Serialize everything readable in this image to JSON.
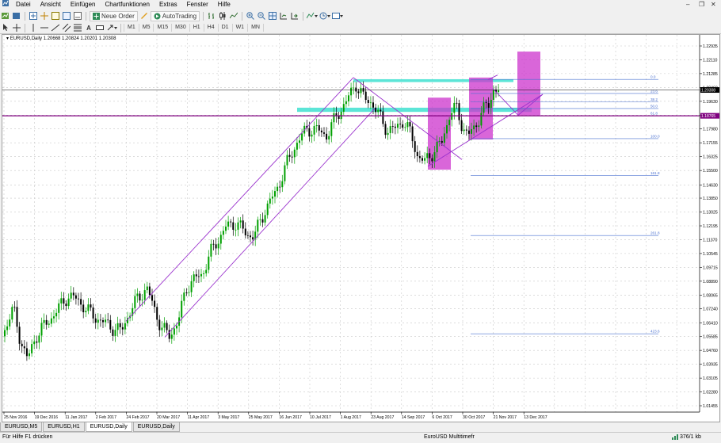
{
  "menu": [
    "Datei",
    "Ansicht",
    "Einfügen",
    "Chartfunktionen",
    "Extras",
    "Fenster",
    "Hilfe"
  ],
  "toolbar": {
    "new_order": "Neue Order",
    "autotrading": "AutoTrading"
  },
  "timeframes": [
    "M1",
    "M5",
    "M15",
    "M30",
    "H1",
    "H4",
    "D1",
    "W1",
    "MN"
  ],
  "chart": {
    "title": "EURUSD,Daily  1.20668 1.20824 1.20201 1.20308",
    "price_labels": [
      "1.22935",
      "1.22110",
      "1.21285",
      "1.20460",
      "1.19630",
      "1.18805",
      "1.17980",
      "1.17155",
      "1.16325",
      "1.15500",
      "1.14630",
      "1.13850",
      "1.13025",
      "1.12195",
      "1.11370",
      "1.10545",
      "1.09715",
      "1.08890",
      "1.08065",
      "1.07240",
      "1.06410",
      "1.05585",
      "1.04760",
      "1.03935",
      "1.03105",
      "1.02280",
      "1.01455"
    ],
    "current_price": "1.20308",
    "hline_price": "1.18765",
    "date_labels": [
      "25 Nov 2016",
      "19 Dec 2016",
      "11 Jan 2017",
      "2 Feb 2017",
      "24 Feb 2017",
      "20 Mar 2017",
      "11 Apr 2017",
      "3 May 2017",
      "25 May 2017",
      "16 Jun 2017",
      "10 Jul 2017",
      "1 Aug 2017",
      "23 Aug 2017",
      "14 Sep 2017",
      "6 Oct 2017",
      "30 Oct 2017",
      "21 Nov 2017",
      "13 Dec 2017"
    ],
    "fib_levels": [
      "0.0",
      "23.6",
      "38.2",
      "50.0",
      "61.8",
      "100.0",
      "161.8",
      "261.8",
      "423.6"
    ],
    "colors": {
      "bull": "#00a000",
      "bear": "#000000",
      "channel": "#9a32cd",
      "zone": "#40e0d0",
      "box": "#cc33cc",
      "fib": "#4a70d0",
      "hline": "#800080"
    }
  },
  "tabs": [
    "EURUSD,M5",
    "EURUSD,H1",
    "EURUSD,Daily",
    "EURUSD,Daily"
  ],
  "active_tab": 2,
  "status": {
    "help": "Für Hilfe F1 drücken",
    "profile": "EuroUSD Multitimefr",
    "traffic": "376/1 kb"
  }
}
